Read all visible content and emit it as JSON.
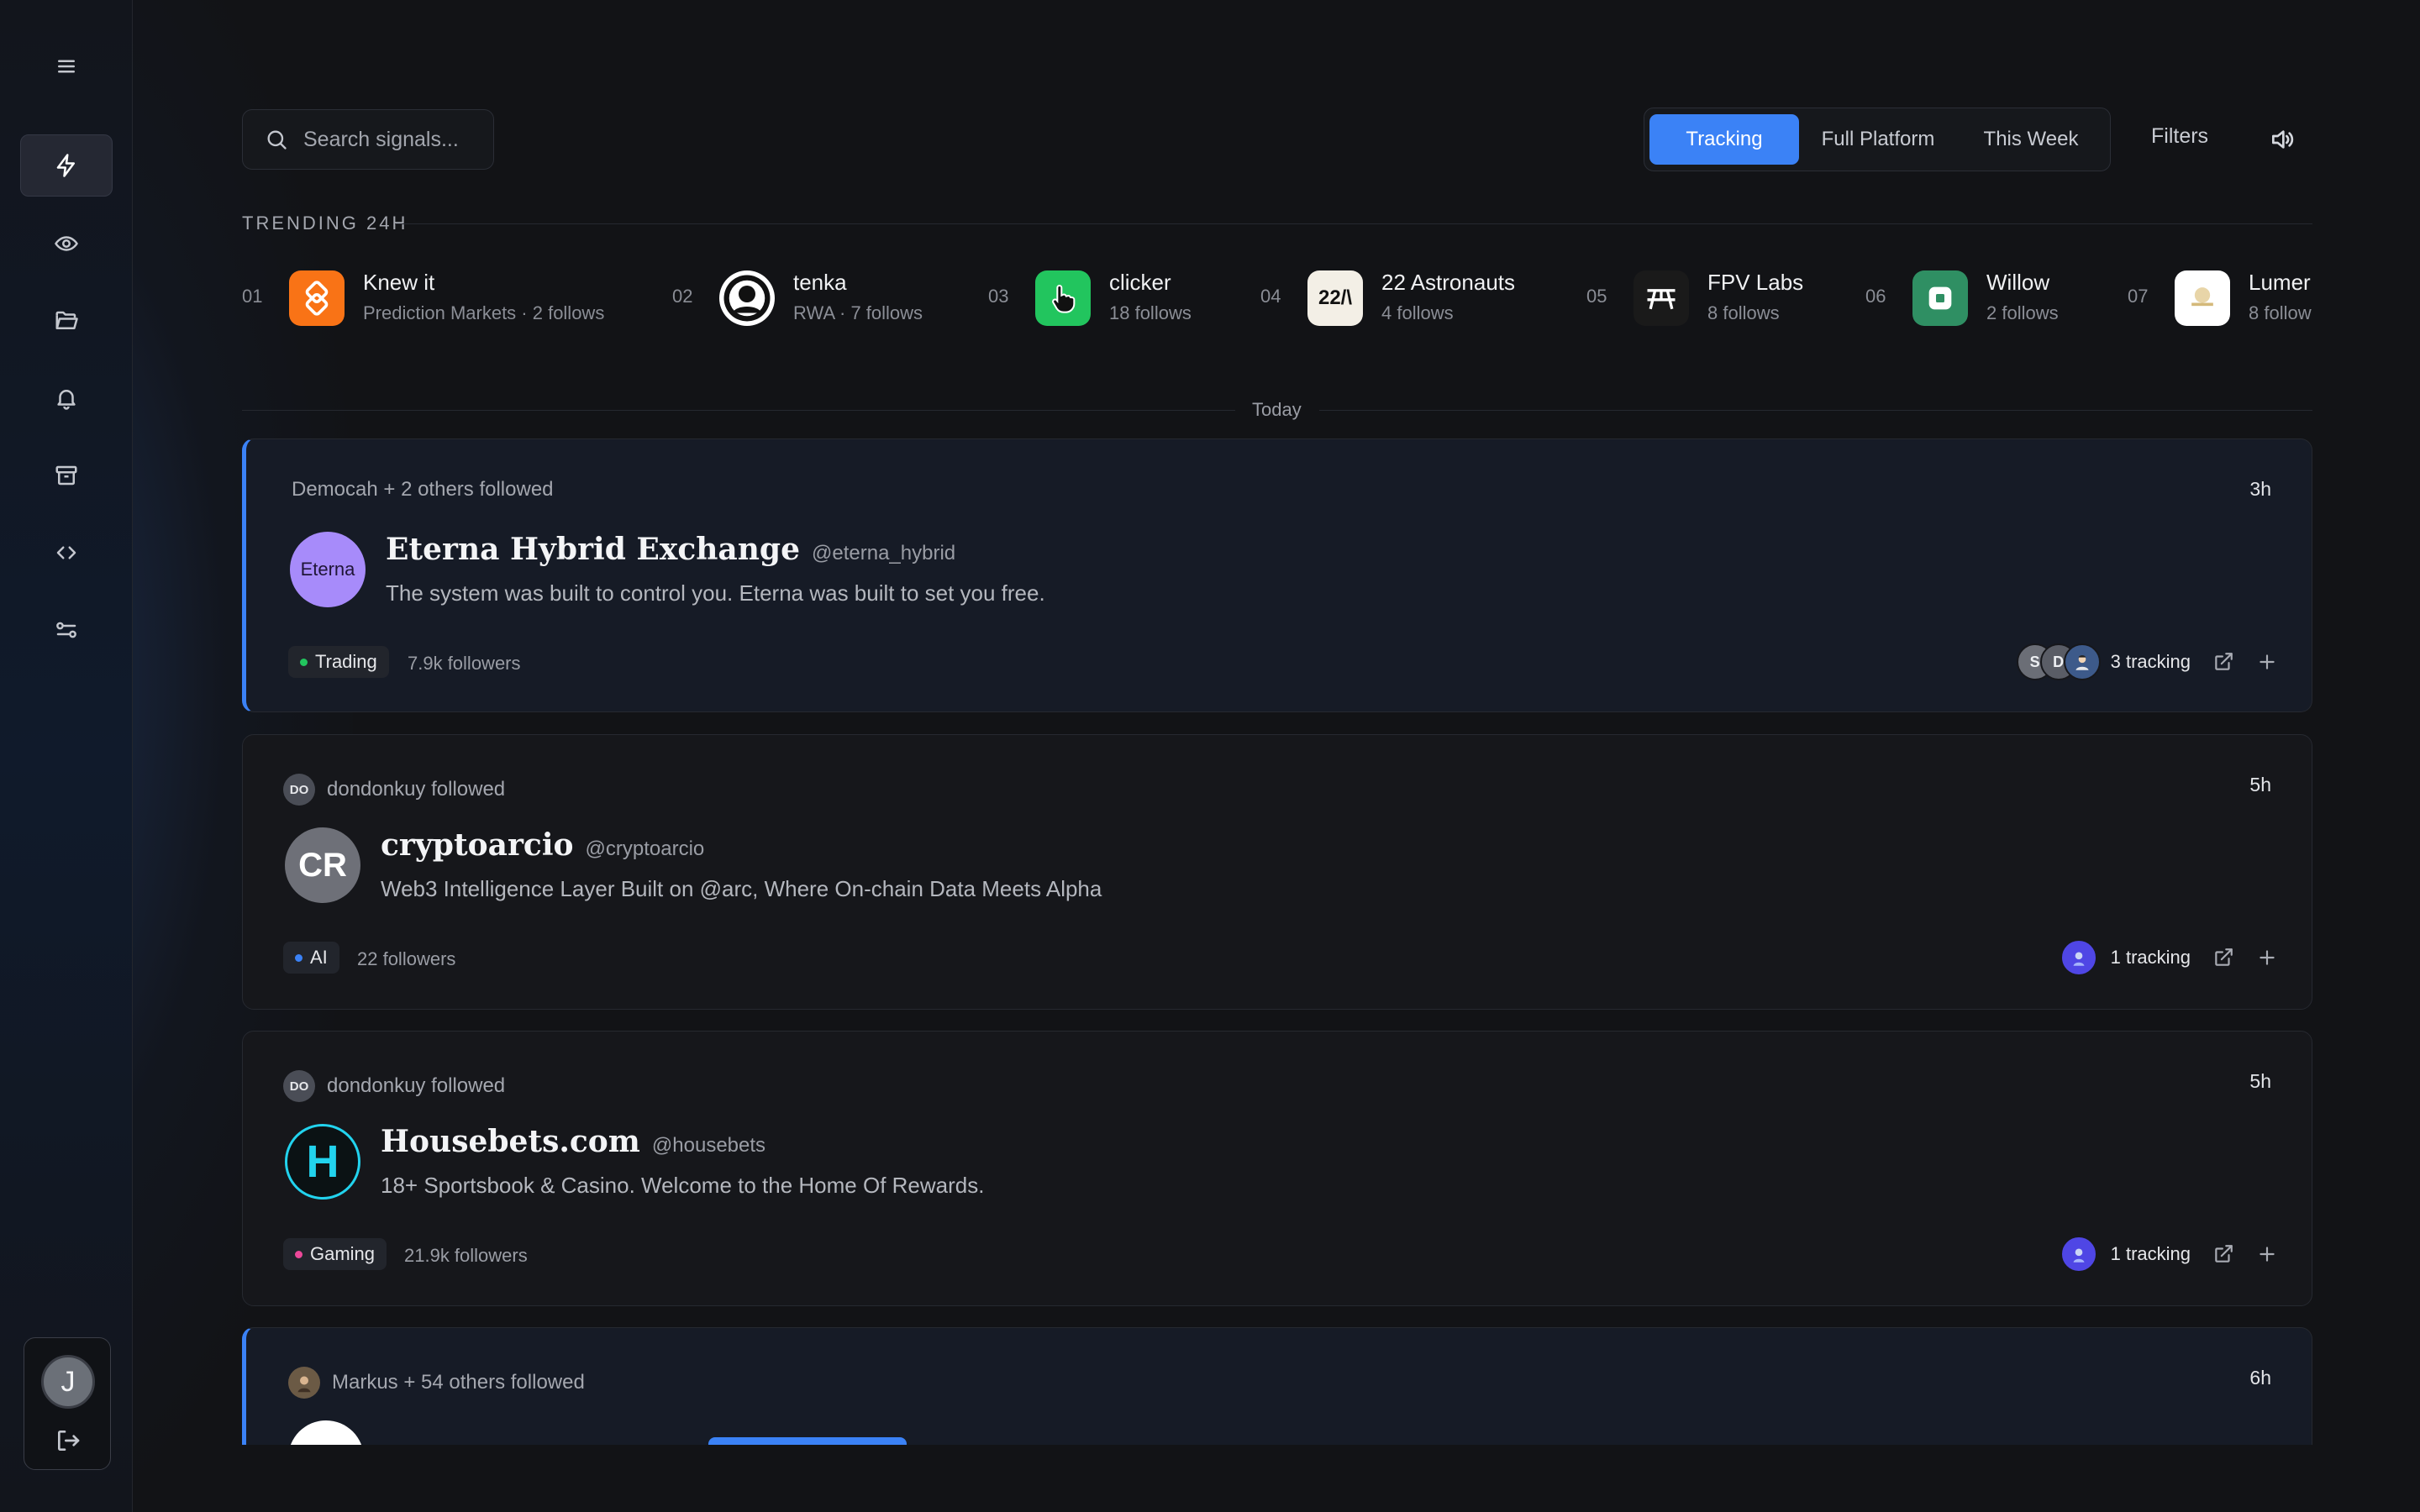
{
  "sidebar": {
    "items": [
      {
        "name": "signals",
        "icon": "lightning-icon",
        "active": true
      },
      {
        "name": "watching",
        "icon": "eye-icon"
      },
      {
        "name": "folders",
        "icon": "folder-icon"
      },
      {
        "name": "notifications",
        "icon": "bell-icon"
      },
      {
        "name": "archive",
        "icon": "archive-icon"
      },
      {
        "name": "developer",
        "icon": "code-icon"
      },
      {
        "name": "settings",
        "icon": "sliders-icon"
      }
    ],
    "user_initial": "J"
  },
  "search": {
    "placeholder": "Search signals..."
  },
  "view_tabs": [
    "Tracking",
    "Full Platform",
    "This Week"
  ],
  "active_tab": "Tracking",
  "filters_label": "Filters",
  "trending": {
    "title": "TRENDING 24H",
    "items": [
      {
        "rank": "01",
        "name": "Knew it",
        "sub": "Prediction Markets · 2 follows",
        "logo_color": "#f97316"
      },
      {
        "rank": "02",
        "name": "tenka",
        "sub": "RWA · 7 follows",
        "logo_color": "#ffffff"
      },
      {
        "rank": "03",
        "name": "clicker",
        "sub": "18 follows",
        "logo_color": "#22c55e"
      },
      {
        "rank": "04",
        "name": "22 Astronauts",
        "sub": "4 follows",
        "logo_text": "22/\\",
        "logo_color": "#f3efe6"
      },
      {
        "rank": "05",
        "name": "FPV Labs",
        "sub": "8 follows",
        "logo_color": "#1a1a1a"
      },
      {
        "rank": "06",
        "name": "Willow",
        "sub": "2 follows",
        "logo_color": "#2f8f63"
      },
      {
        "rank": "07",
        "name": "Lumer",
        "sub": "8 follow",
        "logo_color": "#ffffff"
      }
    ]
  },
  "day_label": "Today",
  "cards": [
    {
      "who": "Democah + 2 others followed",
      "time": "3h",
      "name": "Eterna Hybrid Exchange",
      "handle": "@eterna_hybrid",
      "avatar_text": "Eterna",
      "description": "The system was built to control you. Eterna was built to set you free.",
      "tag": "Trading",
      "tag_color": "#22c55e",
      "followers": "7.9k followers",
      "tracking": "3 tracking",
      "tracker_initials": [
        "S",
        "D",
        ""
      ]
    },
    {
      "who": "dondonkuy followed",
      "who_initials": "DO",
      "time": "5h",
      "name": "cryptoarcio",
      "handle": "@cryptoarcio",
      "avatar_text": "CR",
      "description": "Web3 Intelligence Layer Built on @arc, Where On-chain Data Meets Alpha",
      "tag": "AI",
      "tag_color": "#3b82f6",
      "followers": "22 followers",
      "tracking": "1 tracking"
    },
    {
      "who": "dondonkuy followed",
      "who_initials": "DO",
      "time": "5h",
      "name": "Housebets.com",
      "handle": "@housebets",
      "avatar_text": "H",
      "description": "18+ Sportsbook & Casino. Welcome to the Home Of Rewards.",
      "tag": "Gaming",
      "tag_color": "#ec4899",
      "followers": "21.9k followers",
      "tracking": "1 tracking"
    },
    {
      "who": "Markus + 54 others followed",
      "time": "6h"
    }
  ]
}
